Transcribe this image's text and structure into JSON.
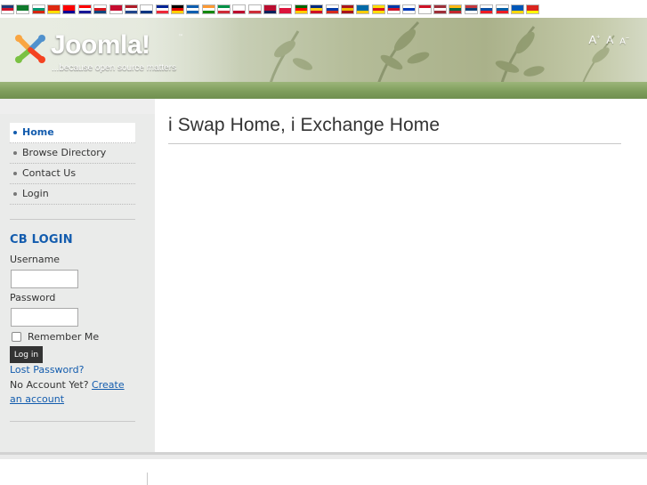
{
  "languages": [
    {
      "code": "en",
      "name": "English",
      "colors": [
        "#1f3b7a",
        "#cf142b",
        "#ffffff"
      ]
    },
    {
      "code": "ar",
      "name": "Arabic",
      "colors": [
        "#0f7a2c",
        "#0f7a2c",
        "#ffffff"
      ]
    },
    {
      "code": "bg",
      "name": "Bulgarian",
      "colors": [
        "#ffffff",
        "#00966e",
        "#d62612"
      ]
    },
    {
      "code": "zh-CN",
      "name": "Chinese (Simplified)",
      "colors": [
        "#de2910",
        "#de2910",
        "#ffde00"
      ]
    },
    {
      "code": "zh-TW",
      "name": "Chinese (Traditional)",
      "colors": [
        "#fe0000",
        "#fe0000",
        "#000095"
      ]
    },
    {
      "code": "hr",
      "name": "Croatian",
      "colors": [
        "#ff0000",
        "#ffffff",
        "#171796"
      ]
    },
    {
      "code": "cs",
      "name": "Czech",
      "colors": [
        "#ffffff",
        "#d7141a",
        "#11457e"
      ]
    },
    {
      "code": "da",
      "name": "Danish",
      "colors": [
        "#c60c30",
        "#c60c30",
        "#ffffff"
      ]
    },
    {
      "code": "nl",
      "name": "Dutch",
      "colors": [
        "#ae1c28",
        "#ffffff",
        "#21468b"
      ]
    },
    {
      "code": "fi",
      "name": "Finnish",
      "colors": [
        "#ffffff",
        "#ffffff",
        "#003580"
      ]
    },
    {
      "code": "fr",
      "name": "French",
      "colors": [
        "#002395",
        "#ffffff",
        "#ed2939"
      ]
    },
    {
      "code": "de",
      "name": "German",
      "colors": [
        "#000000",
        "#dd0000",
        "#ffce00"
      ]
    },
    {
      "code": "el",
      "name": "Greek",
      "colors": [
        "#0d5eaf",
        "#ffffff",
        "#0d5eaf"
      ]
    },
    {
      "code": "hi",
      "name": "Hindi",
      "colors": [
        "#ff9933",
        "#ffffff",
        "#138808"
      ]
    },
    {
      "code": "it",
      "name": "Italian",
      "colors": [
        "#009246",
        "#ffffff",
        "#ce2b37"
      ]
    },
    {
      "code": "ja",
      "name": "Japanese",
      "colors": [
        "#ffffff",
        "#ffffff",
        "#bc002d"
      ]
    },
    {
      "code": "ko",
      "name": "Korean",
      "colors": [
        "#ffffff",
        "#ffffff",
        "#cd2e3a"
      ]
    },
    {
      "code": "no",
      "name": "Norwegian",
      "colors": [
        "#ba0c2f",
        "#ba0c2f",
        "#00205b"
      ]
    },
    {
      "code": "pl",
      "name": "Polish",
      "colors": [
        "#ffffff",
        "#dc143c",
        "#dc143c"
      ]
    },
    {
      "code": "pt",
      "name": "Portuguese",
      "colors": [
        "#006600",
        "#ff0000",
        "#ffcc00"
      ]
    },
    {
      "code": "ro",
      "name": "Romanian",
      "colors": [
        "#002b7f",
        "#fcd116",
        "#ce1126"
      ]
    },
    {
      "code": "ru",
      "name": "Russian",
      "colors": [
        "#ffffff",
        "#0039a6",
        "#d52b1e"
      ]
    },
    {
      "code": "es",
      "name": "Spanish",
      "colors": [
        "#aa151b",
        "#f1bf00",
        "#aa151b"
      ]
    },
    {
      "code": "sv",
      "name": "Swedish",
      "colors": [
        "#006aa7",
        "#006aa7",
        "#fecc00"
      ]
    },
    {
      "code": "ca",
      "name": "Catalan",
      "colors": [
        "#fcdd09",
        "#da121a",
        "#fcdd09"
      ]
    },
    {
      "code": "tl",
      "name": "Filipino",
      "colors": [
        "#0038a8",
        "#ce1126",
        "#ffffff"
      ]
    },
    {
      "code": "iw",
      "name": "Hebrew",
      "colors": [
        "#ffffff",
        "#0038b8",
        "#ffffff"
      ]
    },
    {
      "code": "id",
      "name": "Indonesian",
      "colors": [
        "#ce1126",
        "#ffffff",
        "#ffffff"
      ]
    },
    {
      "code": "lv",
      "name": "Latvian",
      "colors": [
        "#9e3039",
        "#ffffff",
        "#9e3039"
      ]
    },
    {
      "code": "lt",
      "name": "Lithuanian",
      "colors": [
        "#fdb913",
        "#006a44",
        "#c1272d"
      ]
    },
    {
      "code": "sr",
      "name": "Serbian",
      "colors": [
        "#c6363c",
        "#0c4076",
        "#ffffff"
      ]
    },
    {
      "code": "sk",
      "name": "Slovak",
      "colors": [
        "#ffffff",
        "#0b4ea2",
        "#ee1c25"
      ]
    },
    {
      "code": "sl",
      "name": "Slovenian",
      "colors": [
        "#ffffff",
        "#005da4",
        "#ed1c24"
      ]
    },
    {
      "code": "uk",
      "name": "Ukrainian",
      "colors": [
        "#0057b7",
        "#0057b7",
        "#ffd700"
      ]
    },
    {
      "code": "vi",
      "name": "Vietnamese",
      "colors": [
        "#da251d",
        "#da251d",
        "#ffff00"
      ]
    }
  ],
  "header": {
    "logo_text": "Joomla!",
    "logo_tm": "™",
    "tagline": "...because open source matters",
    "font_big": "A",
    "font_big_sup": "+",
    "font_normal": "A",
    "font_small": "A",
    "font_small_sup": "−"
  },
  "sidebar": {
    "menu": [
      {
        "label": "Home",
        "active": true
      },
      {
        "label": "Browse Directory",
        "active": false
      },
      {
        "label": "Contact Us",
        "active": false
      },
      {
        "label": "Login",
        "active": false
      }
    ],
    "login": {
      "title": "CB LOGIN",
      "username_label": "Username",
      "username_value": "",
      "password_label": "Password",
      "password_value": "",
      "remember_label": "Remember Me",
      "remember_checked": false,
      "button_label": "Log in",
      "lost_password": "Lost Password?",
      "no_account": "No Account Yet?",
      "create_account": "Create an account"
    }
  },
  "main": {
    "title": "i Swap Home, i Exchange Home"
  },
  "colors": {
    "link": "#135cae",
    "header_green": "#7f9e5c",
    "sidebar_bg": "#eaebea"
  }
}
